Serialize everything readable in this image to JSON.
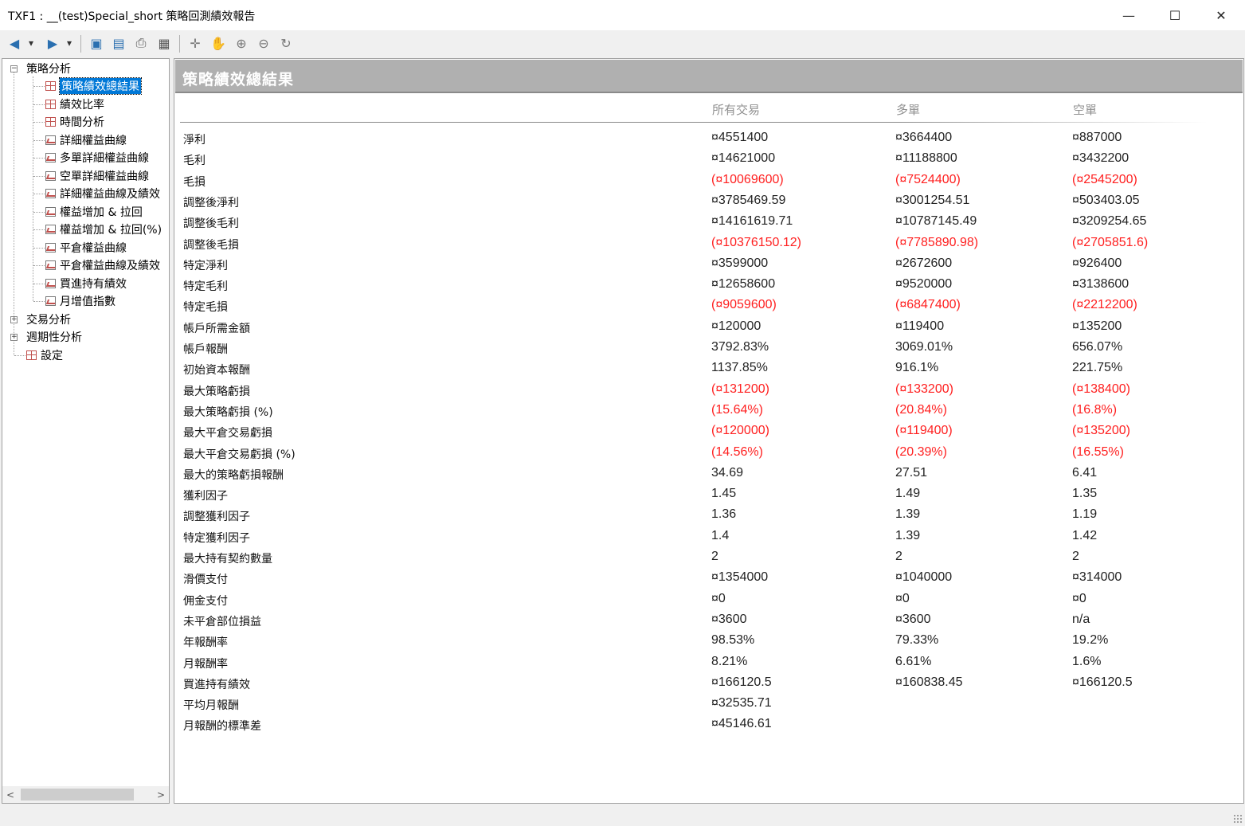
{
  "window": {
    "title": "TXF1 : __(test)Special_short 策略回測績效報告",
    "min_glyph": "—",
    "max_glyph": "☐",
    "close_glyph": "✕"
  },
  "toolbar": {
    "icons": [
      "back-icon",
      "forward-icon",
      "save-icon",
      "preview-icon",
      "print-icon",
      "table-icon",
      "crosshair-icon",
      "pan-hand-icon",
      "zoom-in-icon",
      "zoom-out-icon",
      "reset-icon"
    ],
    "glyphs": {
      "back": "◀",
      "dropdown": "▾",
      "forward": "▶",
      "save": "▣",
      "preview": "▤",
      "print": "⎙",
      "table": "▦",
      "crosshair": "✛",
      "pan": "✋",
      "zoom_in": "⊕",
      "zoom_out": "⊖",
      "reset": "↻"
    }
  },
  "tree": {
    "root_strategy": "策略分析",
    "strategy_items": [
      "策略績效總結果",
      "績效比率",
      "時間分析",
      "詳細權益曲線",
      "多單詳細權益曲線",
      "空單詳細權益曲線",
      "詳細權益曲線及績效",
      "權益增加 & 拉回",
      "權益增加 & 拉回(%)",
      "平倉權益曲線",
      "平倉權益曲線及績效",
      "買進持有績效",
      "月增值指數"
    ],
    "root_trade": "交易分析",
    "root_period": "週期性分析",
    "root_settings": "設定",
    "selected_index": 0,
    "collapsed_glyph": "+",
    "expanded_glyph": "−",
    "scroll_left": "<",
    "scroll_right": ">"
  },
  "report": {
    "title": "策略績效總結果",
    "columns": [
      "所有交易",
      "多單",
      "空單"
    ],
    "rows": [
      {
        "label": "淨利",
        "values": [
          "¤4551400",
          "¤3664400",
          "¤887000"
        ],
        "neg": false
      },
      {
        "label": "毛利",
        "values": [
          "¤14621000",
          "¤11188800",
          "¤3432200"
        ],
        "neg": false
      },
      {
        "label": "毛損",
        "values": [
          "(¤10069600)",
          "(¤7524400)",
          "(¤2545200)"
        ],
        "neg": true
      },
      {
        "label": "調整後淨利",
        "values": [
          "¤3785469.59",
          "¤3001254.51",
          "¤503403.05"
        ],
        "neg": false
      },
      {
        "label": "調整後毛利",
        "values": [
          "¤14161619.71",
          "¤10787145.49",
          "¤3209254.65"
        ],
        "neg": false
      },
      {
        "label": "調整後毛損",
        "values": [
          "(¤10376150.12)",
          "(¤7785890.98)",
          "(¤2705851.6)"
        ],
        "neg": true
      },
      {
        "label": "特定淨利",
        "values": [
          "¤3599000",
          "¤2672600",
          "¤926400"
        ],
        "neg": false
      },
      {
        "label": "特定毛利",
        "values": [
          "¤12658600",
          "¤9520000",
          "¤3138600"
        ],
        "neg": false
      },
      {
        "label": "特定毛損",
        "values": [
          "(¤9059600)",
          "(¤6847400)",
          "(¤2212200)"
        ],
        "neg": true
      },
      {
        "label": "帳戶所需金額",
        "values": [
          "¤120000",
          "¤119400",
          "¤135200"
        ],
        "neg": false
      },
      {
        "label": "帳戶報酬",
        "values": [
          "3792.83%",
          "3069.01%",
          "656.07%"
        ],
        "neg": false
      },
      {
        "label": "初始資本報酬",
        "values": [
          "1137.85%",
          "916.1%",
          "221.75%"
        ],
        "neg": false
      },
      {
        "label": "最大策略虧損",
        "values": [
          "(¤131200)",
          "(¤133200)",
          "(¤138400)"
        ],
        "neg": true
      },
      {
        "label": "最大策略虧損 (%)",
        "values": [
          "(15.64%)",
          "(20.84%)",
          "(16.8%)"
        ],
        "neg": true
      },
      {
        "label": "最大平倉交易虧損",
        "values": [
          "(¤120000)",
          "(¤119400)",
          "(¤135200)"
        ],
        "neg": true
      },
      {
        "label": "最大平倉交易虧損 (%)",
        "values": [
          "(14.56%)",
          "(20.39%)",
          "(16.55%)"
        ],
        "neg": true
      },
      {
        "label": "最大的策略虧損報酬",
        "values": [
          "34.69",
          "27.51",
          "6.41"
        ],
        "neg": false
      },
      {
        "label": "獲利因子",
        "values": [
          "1.45",
          "1.49",
          "1.35"
        ],
        "neg": false
      },
      {
        "label": "調整獲利因子",
        "values": [
          "1.36",
          "1.39",
          "1.19"
        ],
        "neg": false
      },
      {
        "label": "特定獲利因子",
        "values": [
          "1.4",
          "1.39",
          "1.42"
        ],
        "neg": false
      },
      {
        "label": "最大持有契約數量",
        "values": [
          "2",
          "2",
          "2"
        ],
        "neg": false
      },
      {
        "label": "滑價支付",
        "values": [
          "¤1354000",
          "¤1040000",
          "¤314000"
        ],
        "neg": false
      },
      {
        "label": "佣金支付",
        "values": [
          "¤0",
          "¤0",
          "¤0"
        ],
        "neg": false
      },
      {
        "label": "未平倉部位損益",
        "values": [
          "¤3600",
          "¤3600",
          "n/a"
        ],
        "neg": false
      },
      {
        "label": "年報酬率",
        "values": [
          "98.53%",
          "79.33%",
          "19.2%"
        ],
        "neg": false
      },
      {
        "label": "月報酬率",
        "values": [
          "8.21%",
          "6.61%",
          "1.6%"
        ],
        "neg": false
      },
      {
        "label": "買進持有績效",
        "values": [
          "¤166120.5",
          "¤160838.45",
          "¤166120.5"
        ],
        "neg": false
      },
      {
        "label": "平均月報酬",
        "values": [
          "¤32535.71",
          "",
          ""
        ],
        "neg": false
      },
      {
        "label": "月報酬的標準差",
        "values": [
          "¤45146.61",
          "",
          ""
        ],
        "neg": false
      }
    ]
  },
  "colors": {
    "negative": "#ff2020",
    "header_band": "#b0b0b0",
    "selection": "#0078d7"
  }
}
